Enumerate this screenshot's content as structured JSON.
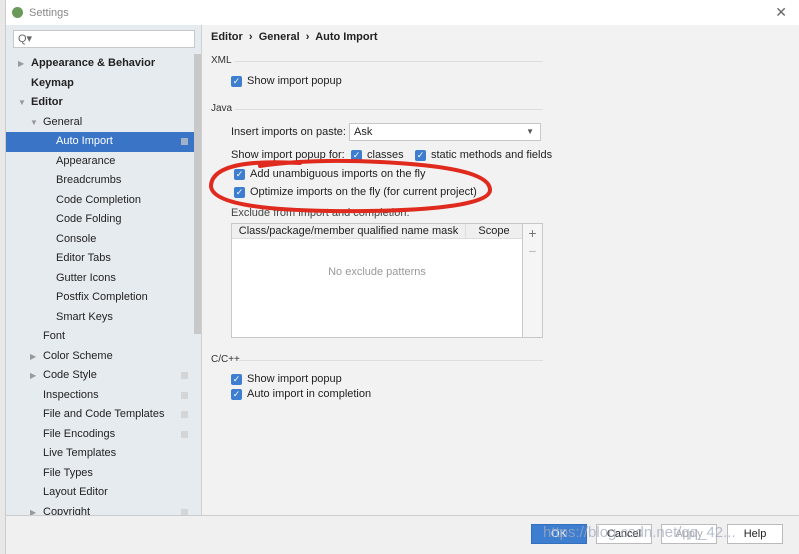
{
  "window": {
    "title": "Settings"
  },
  "search": {
    "placeholder": "Q▾"
  },
  "sidebar": {
    "items": [
      {
        "label": "Appearance & Behavior",
        "level": 0,
        "bold": true,
        "arrow": "▶"
      },
      {
        "label": "Keymap",
        "level": 0,
        "bold": true
      },
      {
        "label": "Editor",
        "level": 0,
        "bold": true,
        "arrow": "▼"
      },
      {
        "label": "General",
        "level": 1,
        "arrow": "▼"
      },
      {
        "label": "Auto Import",
        "level": 2,
        "selected": true,
        "marker": true
      },
      {
        "label": "Appearance",
        "level": 2
      },
      {
        "label": "Breadcrumbs",
        "level": 2
      },
      {
        "label": "Code Completion",
        "level": 2
      },
      {
        "label": "Code Folding",
        "level": 2
      },
      {
        "label": "Console",
        "level": 2
      },
      {
        "label": "Editor Tabs",
        "level": 2
      },
      {
        "label": "Gutter Icons",
        "level": 2
      },
      {
        "label": "Postfix Completion",
        "level": 2
      },
      {
        "label": "Smart Keys",
        "level": 2
      },
      {
        "label": "Font",
        "level": 1
      },
      {
        "label": "Color Scheme",
        "level": 1,
        "arrow": "▶"
      },
      {
        "label": "Code Style",
        "level": 1,
        "arrow": "▶",
        "marker": true
      },
      {
        "label": "Inspections",
        "level": 1,
        "marker": true
      },
      {
        "label": "File and Code Templates",
        "level": 1,
        "marker": true
      },
      {
        "label": "File Encodings",
        "level": 1,
        "marker": true
      },
      {
        "label": "Live Templates",
        "level": 1
      },
      {
        "label": "File Types",
        "level": 1
      },
      {
        "label": "Layout Editor",
        "level": 1
      },
      {
        "label": "Copyright",
        "level": 1,
        "arrow": "▶",
        "marker": true
      }
    ]
  },
  "breadcrumb": {
    "editor": "Editor",
    "general": "General",
    "page": "Auto Import",
    "sep": "›"
  },
  "xml": {
    "title": "XML",
    "show_popup": {
      "label": "Show import popup",
      "checked": true
    }
  },
  "java": {
    "title": "Java",
    "insert_label": "Insert imports on paste:",
    "insert_value": "Ask",
    "popup_for_label": "Show import popup for:",
    "classes": {
      "label": "classes",
      "checked": true
    },
    "static": {
      "label": "static methods and fields",
      "checked": true
    },
    "unambiguous": {
      "label": "Add unambiguous imports on the fly",
      "checked": true
    },
    "optimize": {
      "label": "Optimize imports on the fly (for current project)",
      "checked": true
    },
    "exclude_label": "Exclude from import and completion:",
    "table": {
      "columns": [
        "Class/package/member qualified name mask",
        "Scope"
      ],
      "empty": "No exclude patterns",
      "add": "+",
      "remove": "−"
    }
  },
  "cpp": {
    "title": "C/C++",
    "show_popup": {
      "label": "Show import popup",
      "checked": true
    },
    "auto_import": {
      "label": "Auto import in completion",
      "checked": true
    }
  },
  "footer": {
    "ok": "OK",
    "cancel": "Cancel",
    "apply": "Apply",
    "help": "Help"
  },
  "watermark": "https://blog.csdn.net/qq_42...",
  "colors": {
    "accent": "#3d7ed0",
    "annotation": "#e02a1e",
    "selection": "#3a74c6"
  }
}
